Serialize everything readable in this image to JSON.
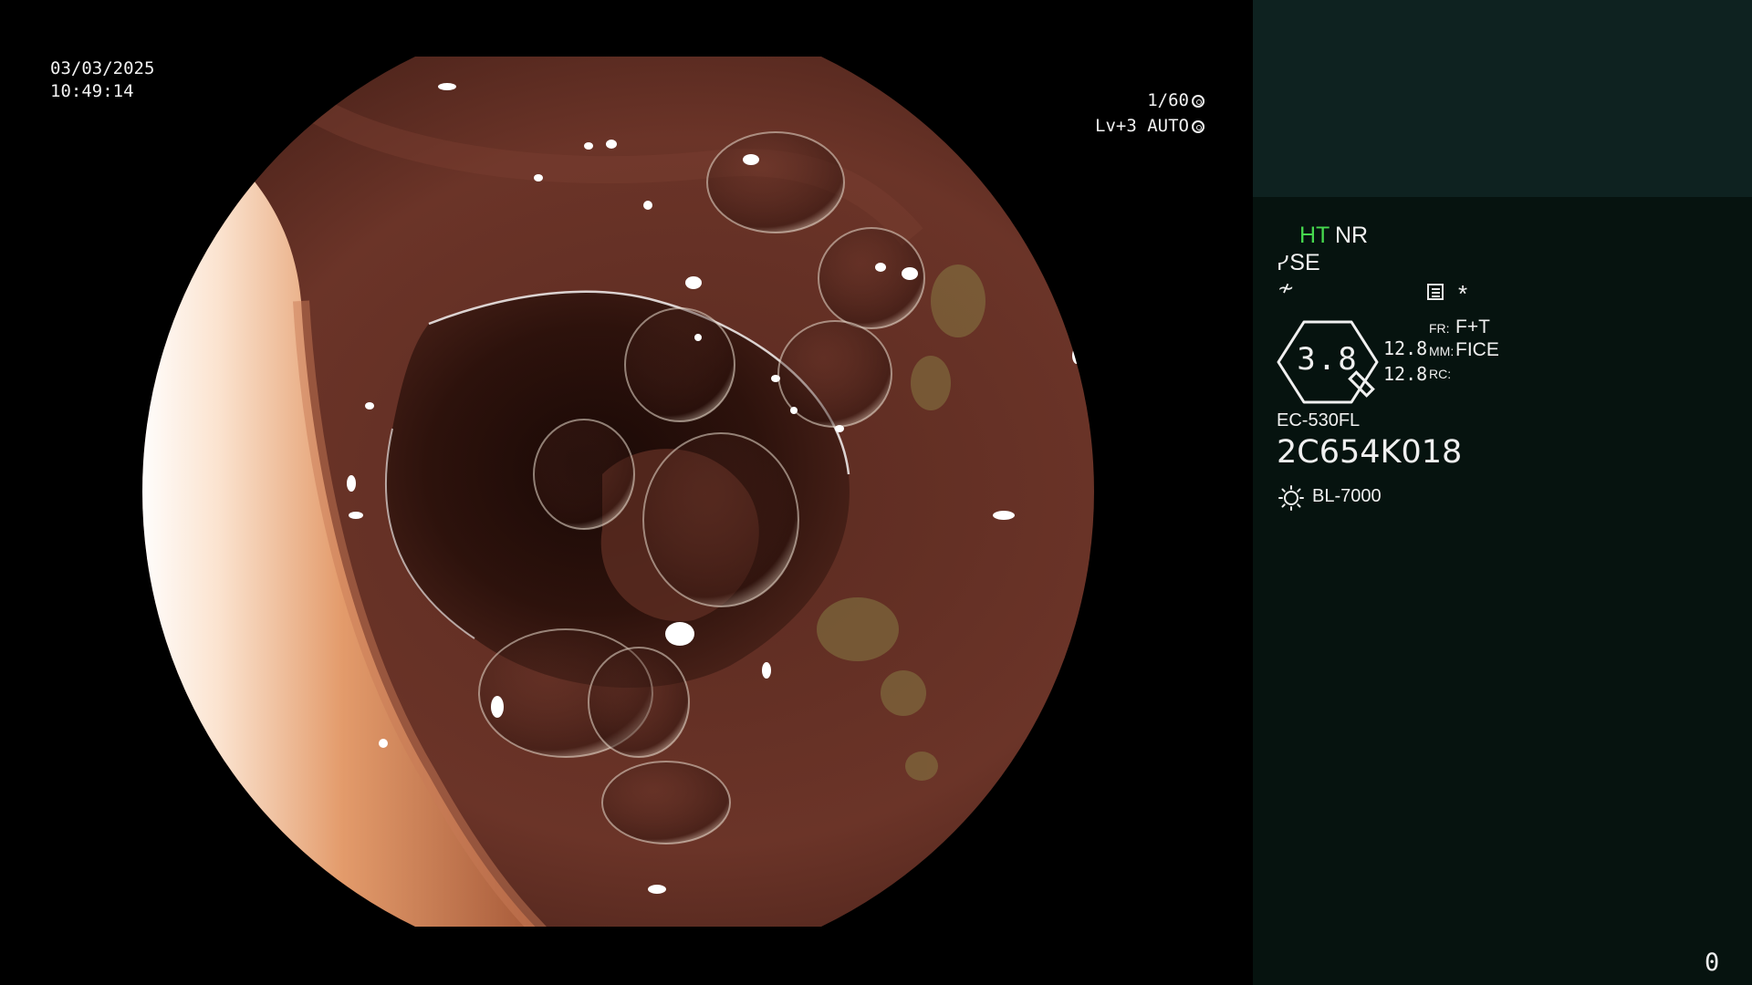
{
  "overlay": {
    "date": "03/03/2025",
    "time": "10:49:14",
    "shutter": "1/60",
    "level": "Lv+3 AUTO"
  },
  "panel": {
    "ht": "HT",
    "nr": "NR",
    "se": "SE",
    "star": "*",
    "gauge_value": "3.8",
    "value_1": "12.8",
    "value_2": "12.8",
    "fr_label": "FR:",
    "fr_value": "F+T",
    "mm_label": "MM:",
    "mm_value": "FICE",
    "rc_label": "RC:",
    "scope_model": "EC-530FL",
    "scope_serial": "2C654K018",
    "light_source": "BL-7000",
    "counter": "0"
  },
  "colors": {
    "ht_indicator": "#46d84e",
    "panel_background": "#06130f",
    "panel_top_background": "#0e2220"
  },
  "icons": [
    "shutter-gear-icon",
    "auto-gear-icon",
    "se-icon",
    "ef-icon",
    "menu-icon",
    "gauge-icon",
    "lamp-icon"
  ]
}
